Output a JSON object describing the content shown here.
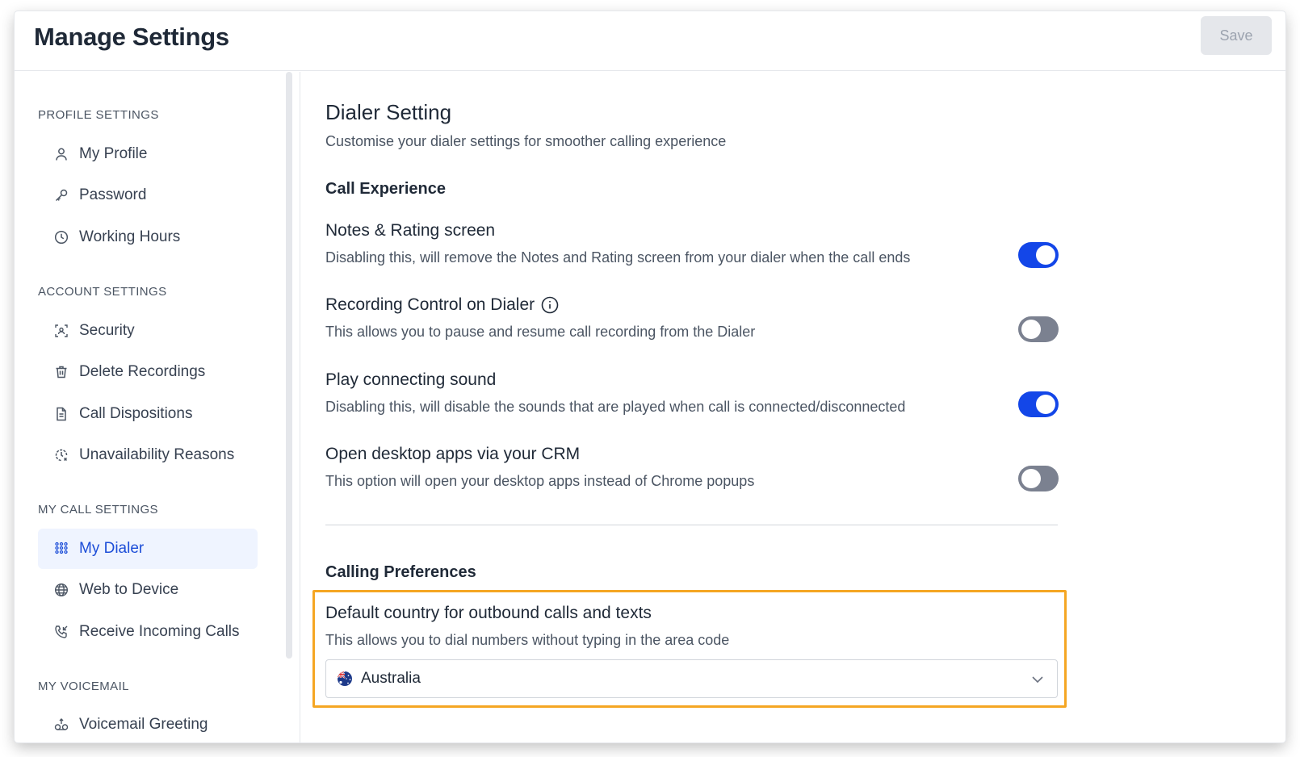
{
  "header": {
    "title": "Manage Settings",
    "save_label": "Save"
  },
  "sidebar": {
    "sections": [
      {
        "label": "PROFILE SETTINGS",
        "items": [
          {
            "label": "My Profile",
            "icon": "user-icon"
          },
          {
            "label": "Password",
            "icon": "key-icon"
          },
          {
            "label": "Working Hours",
            "icon": "clock-icon"
          }
        ]
      },
      {
        "label": "ACCOUNT SETTINGS",
        "items": [
          {
            "label": "Security",
            "icon": "security-scan-icon"
          },
          {
            "label": "Delete Recordings",
            "icon": "trash-icon"
          },
          {
            "label": "Call Dispositions",
            "icon": "document-icon"
          },
          {
            "label": "Unavailability Reasons",
            "icon": "unavailable-icon"
          }
        ]
      },
      {
        "label": "MY CALL SETTINGS",
        "items": [
          {
            "label": "My Dialer",
            "icon": "dialpad-icon",
            "active": true
          },
          {
            "label": "Web to Device",
            "icon": "globe-icon"
          },
          {
            "label": "Receive Incoming Calls",
            "icon": "phone-incoming-icon"
          }
        ]
      },
      {
        "label": "MY VOICEMAIL",
        "items": [
          {
            "label": "Voicemail Greeting",
            "icon": "voicemail-icon"
          }
        ]
      }
    ]
  },
  "main": {
    "title": "Dialer Setting",
    "subtitle": "Customise your dialer settings for smoother calling experience",
    "call_experience": {
      "heading": "Call Experience",
      "settings": [
        {
          "title": "Notes & Rating screen",
          "description": "Disabling this, will remove the Notes and Rating screen from your dialer when the call ends",
          "enabled": true
        },
        {
          "title": "Recording Control on Dialer",
          "description": "This allows you to pause and resume call recording from the Dialer",
          "enabled": false,
          "info_icon": "info-icon"
        },
        {
          "title": "Play connecting sound",
          "description": "Disabling this, will disable the sounds that are played when call is connected/disconnected",
          "enabled": true
        },
        {
          "title": "Open desktop apps via your CRM",
          "description": "This option will open your desktop apps instead of Chrome popups",
          "enabled": false
        }
      ]
    },
    "calling_preferences": {
      "heading": "Calling Preferences",
      "default_country": {
        "title": "Default country for outbound calls and texts",
        "description": "This allows you to dial numbers without typing in the area code",
        "selected": "Australia",
        "flag_icon": "australia-flag-icon"
      }
    }
  },
  "colors": {
    "accent": "#1346e8",
    "toggle_off": "#7b8190",
    "highlight": "#f5a623",
    "active_nav_bg": "#eff4ff",
    "active_nav_text": "#1d4ed8"
  }
}
